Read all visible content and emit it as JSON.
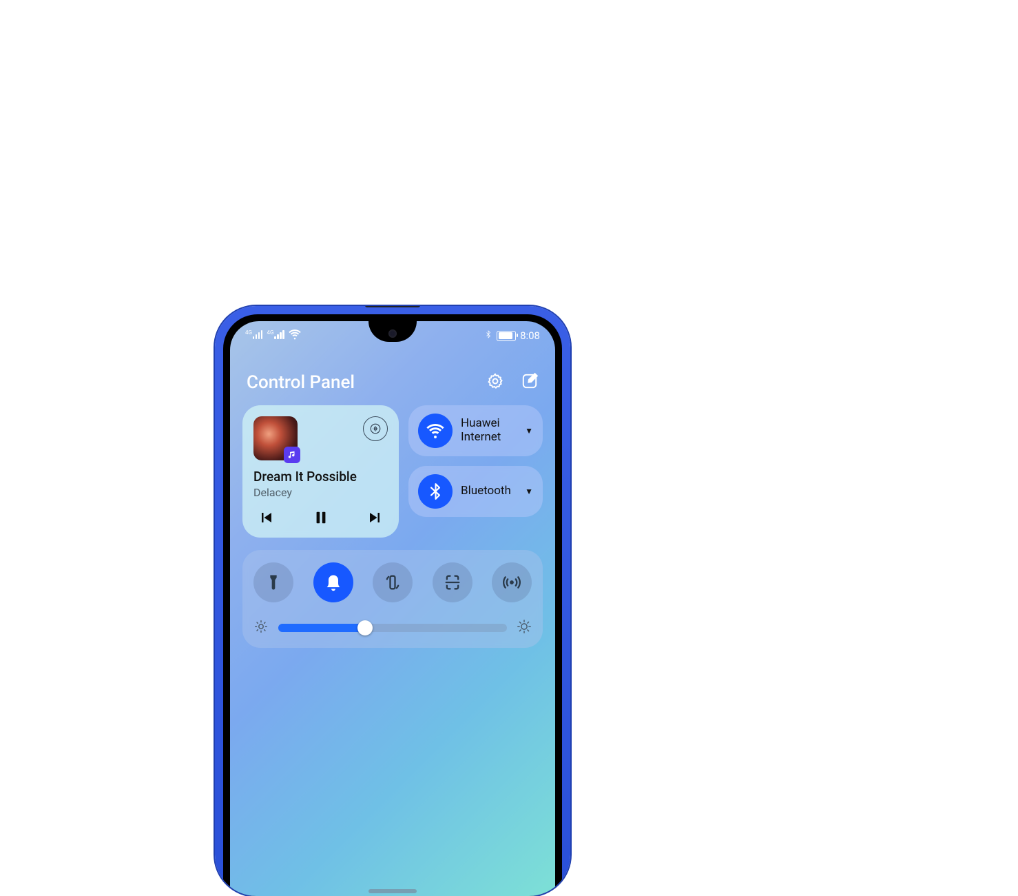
{
  "status": {
    "time": "8:08"
  },
  "header": {
    "title": "Control Panel"
  },
  "music": {
    "track": "Dream It Possible",
    "artist": "Delacey"
  },
  "conn": {
    "wifi": {
      "line1": "Huawei",
      "line2": "Internet"
    },
    "bluetooth": {
      "label": "Bluetooth"
    }
  },
  "brightness": {
    "percent": 38
  },
  "icons": {
    "settings": "gear-icon",
    "edit": "edit-icon",
    "toggles": [
      "flashlight",
      "sound",
      "rotate",
      "screenshot",
      "hotspot"
    ]
  },
  "colors": {
    "accent": "#1758ff"
  }
}
